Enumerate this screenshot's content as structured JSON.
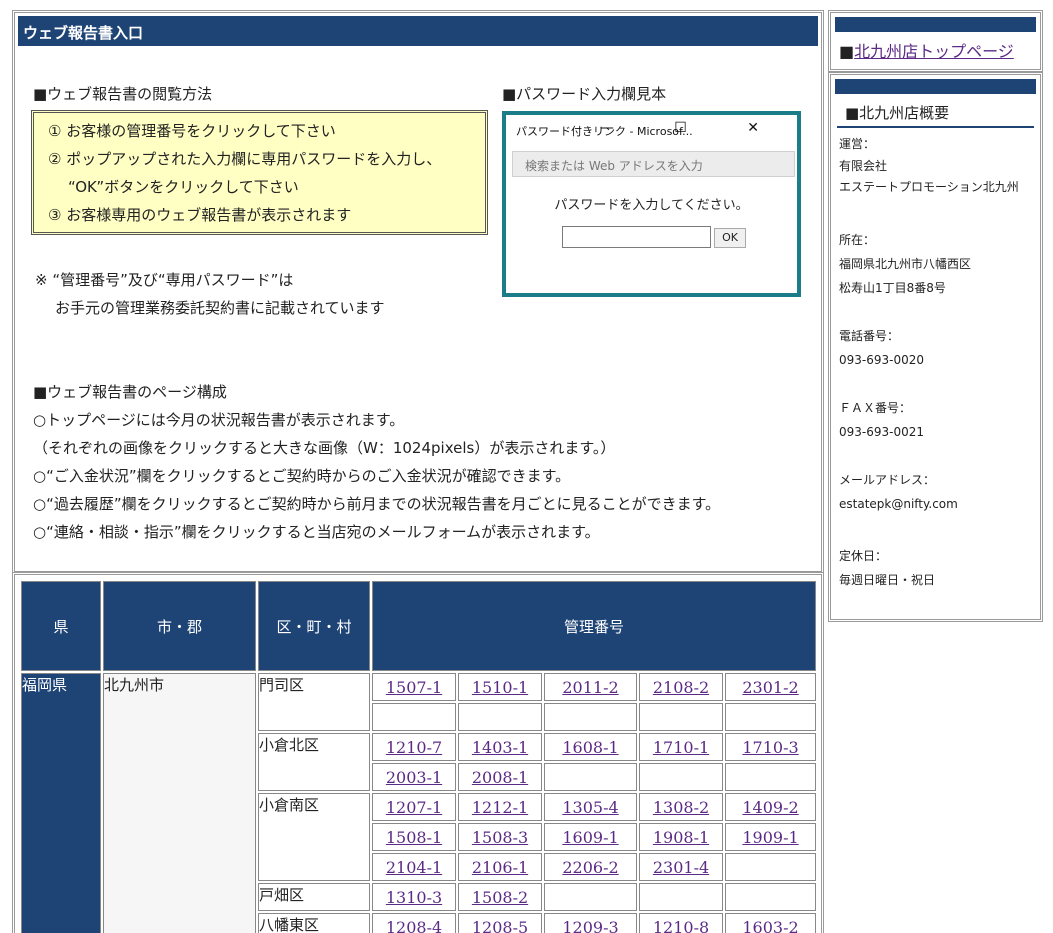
{
  "main": {
    "title": "ウェブ報告書入口",
    "howto_heading": "■ウェブ報告書の閲覧方法",
    "steps": [
      "① お客様の管理番号をクリックして下さい",
      "② ポップアップされた入力欄に専用パスワードを入力し、",
      "“OK”ボタンをクリックして下さい",
      "③ お客様専用のウェブ報告書が表示されます"
    ],
    "sample_heading": "■パスワード入力欄見本",
    "sample": {
      "window_title": "パスワード付きリンク - Microsof...",
      "controls": "— ☐ ✕",
      "address_placeholder": "検索または Web アドレスを入力",
      "prompt": "パスワードを入力してください。",
      "ok_label": "OK"
    },
    "note_line1": "※ “管理番号”及び“専用パスワード”は",
    "note_line2": "お手元の管理業務委託契約書に記載されています",
    "structure_heading": "■ウェブ報告書のページ構成",
    "structure_lines": [
      "○トップページには今月の状況報告書が表示されます。",
      "（それぞれの画像をクリックすると大きな画像（W：1024pixels）が表示されます。）",
      "○“ご入金状況”欄をクリックするとご契約時からのご入金状況が確認できます。",
      "○“過去履歴”欄をクリックするとご契約時から前月までの状況報告書を月ごとに見ることができます。",
      "○“連絡・相談・指示”欄をクリックすると当店宛のメールフォームが表示されます。"
    ]
  },
  "table": {
    "headers": [
      "県",
      "市・郡",
      "区・町・村",
      "管理番号"
    ],
    "prefecture": "福岡県",
    "city": "北九州市",
    "wards": [
      {
        "name": "門司区",
        "rows": [
          [
            "1507-1",
            "1510-1",
            "2011-2",
            "2108-2",
            "2301-2"
          ],
          [
            "",
            "",
            "",
            "",
            ""
          ]
        ]
      },
      {
        "name": "小倉北区",
        "rows": [
          [
            "1210-7",
            "1403-1",
            "1608-1",
            "1710-1",
            "1710-3"
          ],
          [
            "2003-1",
            "2008-1",
            "",
            "",
            ""
          ]
        ]
      },
      {
        "name": "小倉南区",
        "rows": [
          [
            "1207-1",
            "1212-1",
            "1305-4",
            "1308-2",
            "1409-2"
          ],
          [
            "1508-1",
            "1508-3",
            "1609-1",
            "1908-1",
            "1909-1"
          ],
          [
            "2104-1",
            "2106-1",
            "2206-2",
            "2301-4",
            ""
          ]
        ]
      },
      {
        "name": "戸畑区",
        "rows": [
          [
            "1310-3",
            "1508-2",
            "",
            "",
            ""
          ]
        ]
      },
      {
        "name": "八幡東区",
        "rows": [
          [
            "1208-4",
            "1208-5",
            "1209-3",
            "1210-8",
            "1603-2"
          ]
        ]
      }
    ]
  },
  "sidebar": {
    "top_link": "北九州店トップページ",
    "top_link_prefix": "■",
    "info_heading": "■北九州店概要",
    "operator_label": "運営：",
    "operator_line1": "有限会社",
    "operator_line2": "エステートプロモーション北九州",
    "address_label": "所在：",
    "address_line1": "福岡県北九州市八幡西区",
    "address_line2": "松寿山1丁目8番8号",
    "phone_label": "電話番号：",
    "phone": "093-693-0020",
    "fax_label": "ＦＡＸ番号：",
    "fax": "093-693-0021",
    "email_label": "メールアドレス：",
    "email": "estatepk@nifty.com",
    "holiday_label": "定休日：",
    "holiday": "毎週日曜日・祝日"
  },
  "colors": {
    "header_navy": "#1e4476",
    "note_yellow": "#ffffc4",
    "sample_frame_teal": "#1b7d88",
    "link_purple": "#5b2a86"
  }
}
